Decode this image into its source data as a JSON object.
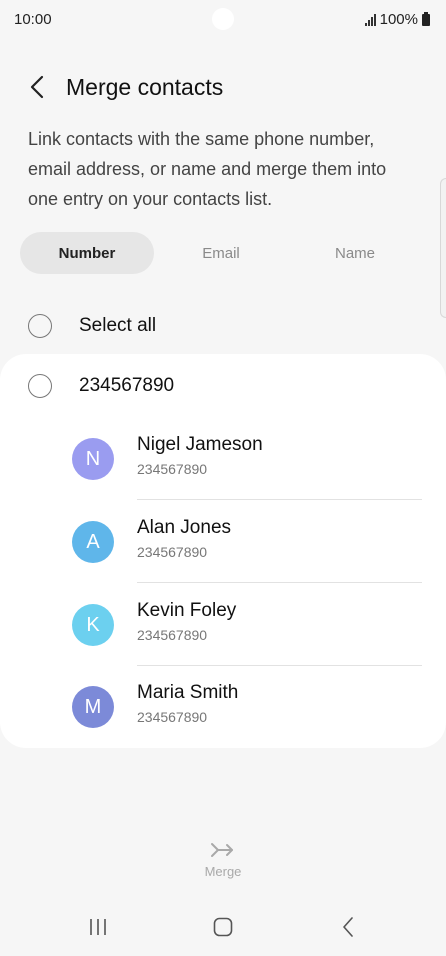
{
  "status_bar": {
    "time": "10:00",
    "battery": "100%"
  },
  "header": {
    "title": "Merge contacts",
    "back_icon": "chevron-left-icon"
  },
  "description": "Link contacts with the same phone number, email address, or name and merge them into one entry on your contacts list.",
  "tabs": [
    {
      "label": "Number",
      "active": true
    },
    {
      "label": "Email",
      "active": false
    },
    {
      "label": "Name",
      "active": false
    }
  ],
  "select_all": {
    "label": "Select all",
    "checked": false
  },
  "group": {
    "number": "234567890",
    "checked": false,
    "contacts": [
      {
        "initial": "N",
        "name": "Nigel Jameson",
        "phone": "234567890",
        "color": "#9a9cf0"
      },
      {
        "initial": "A",
        "name": "Alan Jones",
        "phone": "234567890",
        "color": "#5fb6ea"
      },
      {
        "initial": "K",
        "name": "Kevin Foley",
        "phone": "234567890",
        "color": "#6cd0ef"
      },
      {
        "initial": "M",
        "name": "Maria Smith",
        "phone": "234567890",
        "color": "#7c8ad8"
      }
    ]
  },
  "merge": {
    "label": "Merge",
    "icon": "merge-arrow-icon",
    "enabled": false
  },
  "nav": {
    "recents_icon": "recents-icon",
    "home_icon": "home-icon",
    "back_icon": "back-icon"
  }
}
